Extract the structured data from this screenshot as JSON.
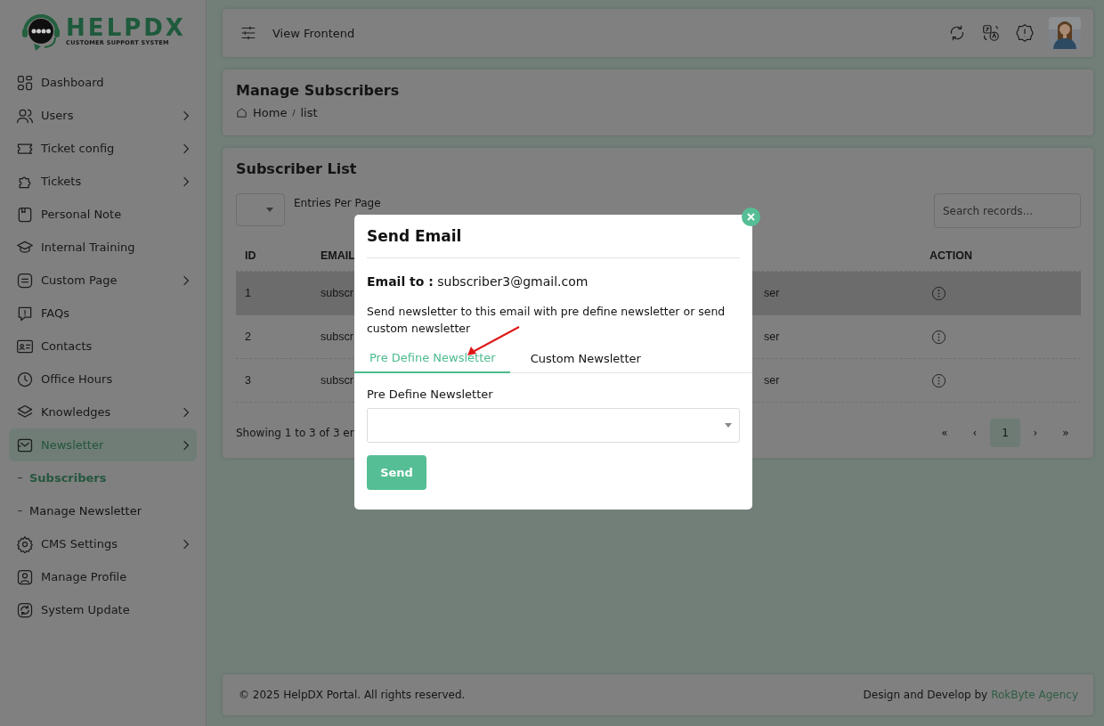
{
  "logo": {
    "title": "HELPDX",
    "subtitle": "CUSTOMER SUPPORT SYSTEM"
  },
  "sidebar": {
    "items": [
      {
        "label": "Dashboard",
        "submenu": false,
        "selected": false
      },
      {
        "label": "Users",
        "submenu": true,
        "selected": false
      },
      {
        "label": "Ticket config",
        "submenu": true,
        "selected": false
      },
      {
        "label": "Tickets",
        "submenu": true,
        "selected": false
      },
      {
        "label": "Personal Note",
        "submenu": false,
        "selected": false
      },
      {
        "label": "Internal Training",
        "submenu": false,
        "selected": false
      },
      {
        "label": "Custom Page",
        "submenu": true,
        "selected": false
      },
      {
        "label": "FAQs",
        "submenu": false,
        "selected": false
      },
      {
        "label": "Contacts",
        "submenu": false,
        "selected": false
      },
      {
        "label": "Office Hours",
        "submenu": false,
        "selected": false
      },
      {
        "label": "Knowledges",
        "submenu": true,
        "selected": false
      },
      {
        "label": "Newsletter",
        "submenu": true,
        "selected": true,
        "children": [
          {
            "label": "Subscribers",
            "selected": true
          },
          {
            "label": "Manage Newsletter",
            "selected": false
          }
        ]
      },
      {
        "label": "CMS Settings",
        "submenu": true,
        "selected": false
      },
      {
        "label": "Manage Profile",
        "submenu": false,
        "selected": false
      },
      {
        "label": "System Update",
        "submenu": false,
        "selected": false
      }
    ]
  },
  "topbar": {
    "link": "View Frontend"
  },
  "header": {
    "title": "Manage Subscribers",
    "breadcrumb": [
      "Home",
      "list"
    ],
    "separator": "/"
  },
  "list": {
    "title": "Subscriber List",
    "entries_label": "Entries Per Page",
    "search": {
      "placeholder": "Search records..."
    },
    "columns": [
      "ID",
      "EMAIL",
      "ACTION"
    ],
    "rows": [
      {
        "id": "1",
        "email": "subscr",
        "column_3": "ser",
        "selected": true
      },
      {
        "id": "2",
        "email": "subscr",
        "column_3": "ser",
        "selected": false
      },
      {
        "id": "3",
        "email": "subscr",
        "column_3": "ser",
        "selected": false
      }
    ],
    "showing": "Showing 1 to 3 of 3 en",
    "pagination": [
      {
        "label": "«",
        "selected": false
      },
      {
        "label": "‹",
        "selected": false
      },
      {
        "label": "1",
        "selected": true
      },
      {
        "label": "›",
        "selected": false
      },
      {
        "label": "»",
        "selected": false
      }
    ]
  },
  "footer": {
    "copyright": "© 2025 HelpDX Portal. All rights reserved.",
    "credit": "Design and Develop by",
    "credit_link": "RokByte Agency"
  },
  "modal": {
    "title": "Send Email",
    "email_label": "Email to :",
    "email": "subscriber3@gmail.com",
    "text": "Send newsletter to this email with pre define newsletter or send custom newsletter",
    "tabs": [
      {
        "label": "Pre Define Newsletter",
        "selected": true
      },
      {
        "label": "Custom Newsletter",
        "selected": false
      }
    ],
    "field_label": "Pre Define Newsletter",
    "button": "Send"
  }
}
